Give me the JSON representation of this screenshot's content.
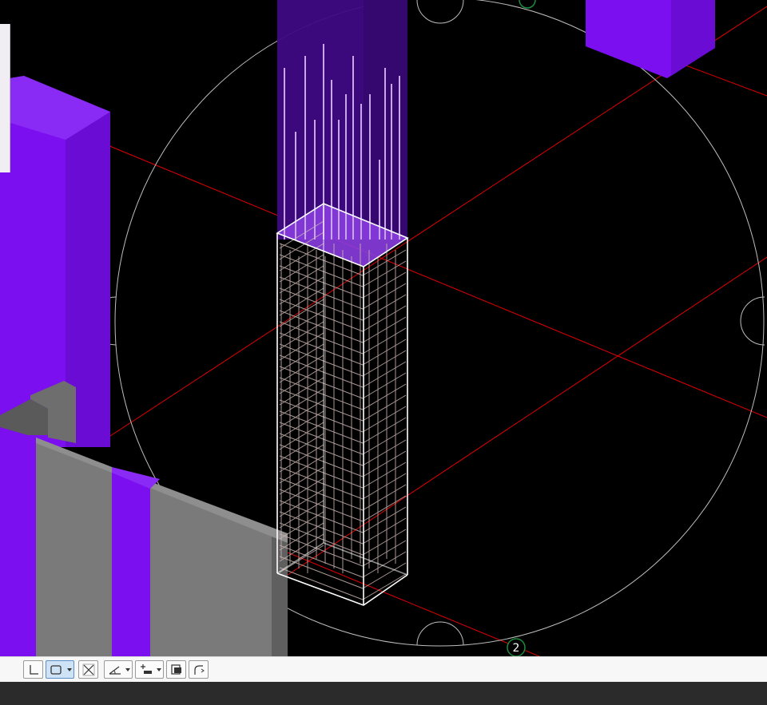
{
  "viewport": {
    "background": "#000000",
    "grid_bubble_label": "2",
    "grid_line_color": "#e00000",
    "selected_column_color": "#7a2ad6",
    "wall_color": "#7b0ff0",
    "concrete_color": "#7a7a7a",
    "rebar_color": "#c8b4b0"
  },
  "toolbar": {
    "buttons": [
      {
        "name": "snap-end-point-button",
        "icon": "corner-angle-icon",
        "has_dropdown": false,
        "active": false
      },
      {
        "name": "snap-rectangle-button",
        "icon": "rectangle-icon",
        "has_dropdown": true,
        "active": true
      },
      {
        "name": "snap-intersection-button",
        "icon": "cross-x-icon",
        "has_dropdown": false,
        "active": false
      },
      {
        "name": "snap-angle-button",
        "icon": "angle-icon",
        "has_dropdown": true,
        "active": false
      },
      {
        "name": "snap-extension-button",
        "icon": "extension-icon",
        "has_dropdown": true,
        "active": false
      },
      {
        "name": "snap-object-button",
        "icon": "object-snap-icon",
        "has_dropdown": false,
        "active": false
      },
      {
        "name": "snap-curve-button",
        "icon": "curve-icon",
        "has_dropdown": false,
        "active": false
      }
    ]
  },
  "status_bar": {}
}
